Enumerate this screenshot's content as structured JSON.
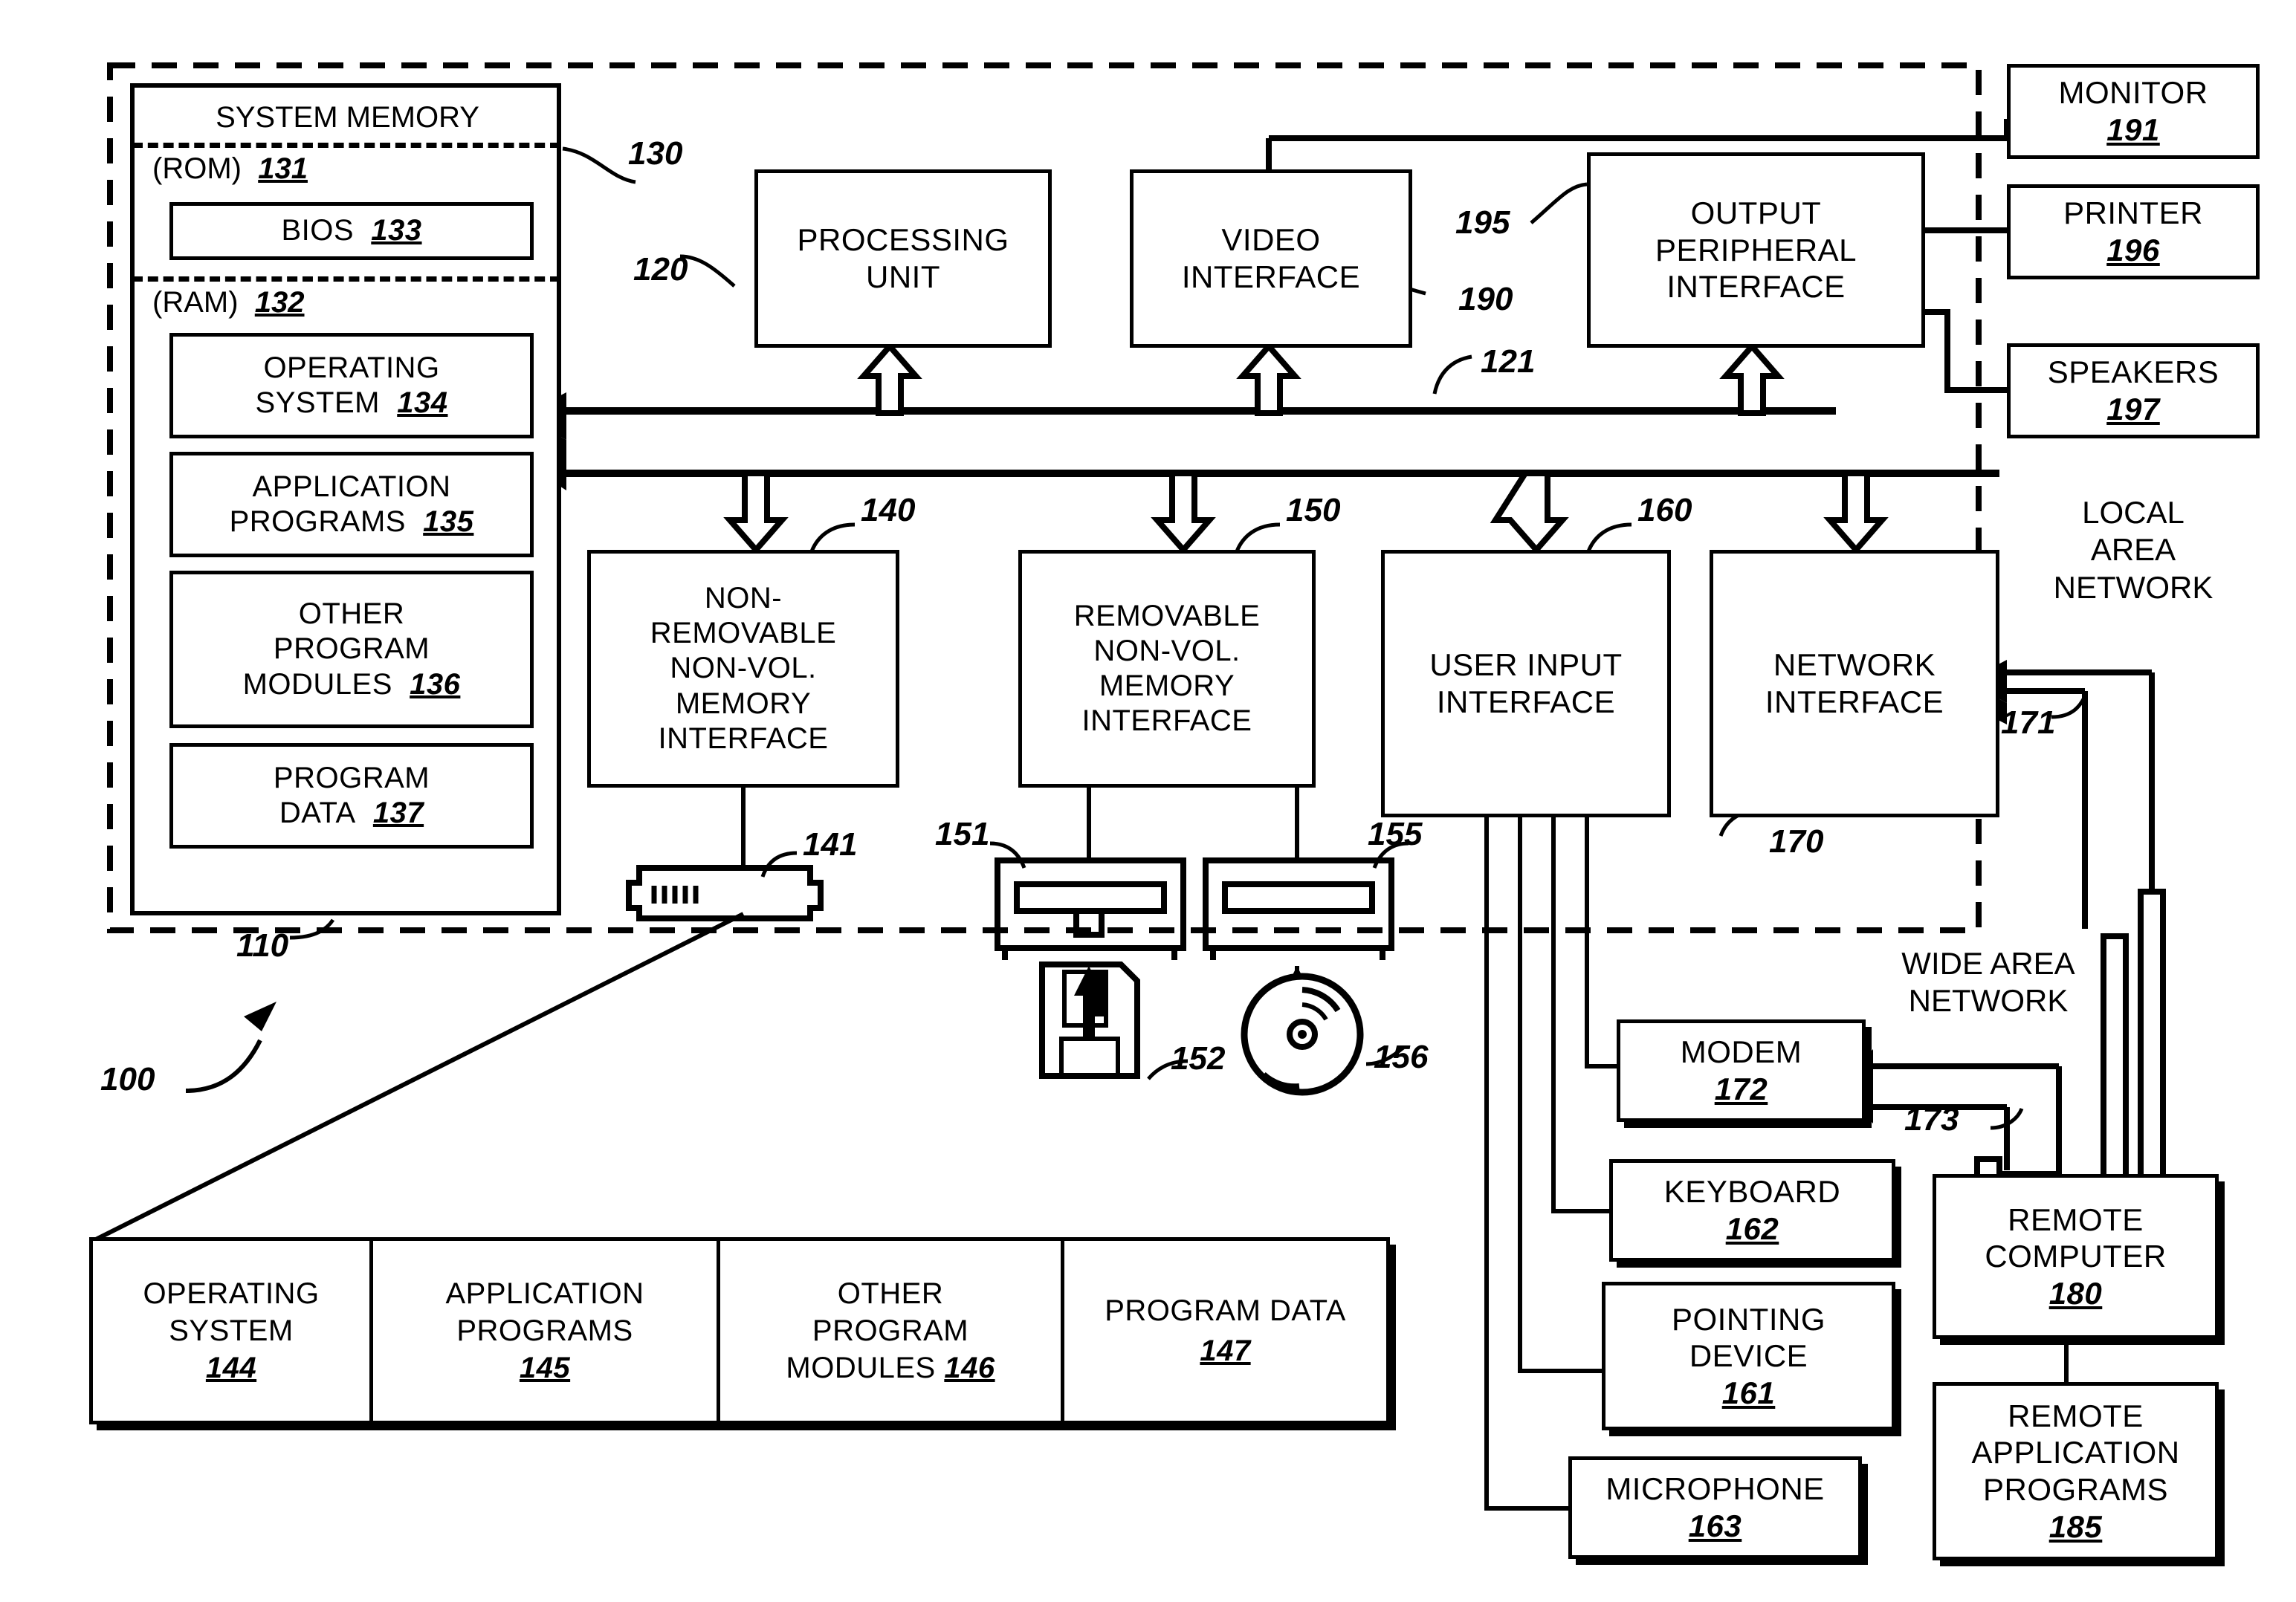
{
  "figure": {
    "overall_ref": "100",
    "computer_ref": "110",
    "system_bus_ref": "121",
    "system_memory_ref": "130",
    "processing_unit_ref": "120",
    "video_interface_ref": "190",
    "output_peripheral_ref": "195",
    "nonremovable_ref": "140",
    "removable_ref": "150",
    "user_input_ref": "160",
    "network_interface_ref": "170",
    "hard_drive_ref": "141",
    "floppy_drive_ref": "151",
    "floppy_disk_ref": "152",
    "optical_drive_ref": "155",
    "optical_disc_ref": "156",
    "lan_link_ref": "171",
    "wan_link_ref": "173"
  },
  "system_memory": {
    "title": "SYSTEM MEMORY",
    "rom": {
      "label": "(ROM)",
      "num": "131"
    },
    "bios": {
      "label": "BIOS",
      "num": "133"
    },
    "ram": {
      "label": "(RAM)",
      "num": "132"
    },
    "blocks": [
      {
        "name": "operating-system",
        "line1": "OPERATING",
        "line2": "SYSTEM",
        "num": "134"
      },
      {
        "name": "application-programs",
        "line1": "APPLICATION",
        "line2": "PROGRAMS",
        "num": "135"
      },
      {
        "name": "other-program-modules",
        "line1": "OTHER",
        "line2": "PROGRAM",
        "line3": "MODULES",
        "num": "136"
      },
      {
        "name": "program-data",
        "line1": "PROGRAM",
        "line2": "DATA",
        "num": "137"
      }
    ]
  },
  "core": {
    "processing_unit": {
      "line1": "PROCESSING",
      "line2": "UNIT"
    },
    "video_interface": {
      "line1": "VIDEO",
      "line2": "INTERFACE"
    },
    "output_peripheral_interface": {
      "line1": "OUTPUT",
      "line2": "PERIPHERAL",
      "line3": "INTERFACE"
    },
    "nonremovable_interface": {
      "line1": "NON-",
      "line2": "REMOVABLE",
      "line3": "NON-VOL.",
      "line4": "MEMORY",
      "line5": "INTERFACE"
    },
    "removable_interface": {
      "line1": "REMOVABLE",
      "line2": "NON-VOL.",
      "line3": "MEMORY",
      "line4": "INTERFACE"
    },
    "user_input_interface": {
      "line1": "USER INPUT",
      "line2": "INTERFACE"
    },
    "network_interface": {
      "line1": "NETWORK",
      "line2": "INTERFACE"
    }
  },
  "output_devices": [
    {
      "name": "monitor",
      "label": "MONITOR",
      "num": "191"
    },
    {
      "name": "printer",
      "label": "PRINTER",
      "num": "196"
    },
    {
      "name": "speakers",
      "label": "SPEAKERS",
      "num": "197"
    }
  ],
  "networks": {
    "lan": "LOCAL\nAREA\nNETWORK",
    "wan": "WIDE AREA\nNETWORK"
  },
  "input_devices": [
    {
      "name": "modem",
      "label": "MODEM",
      "num": "172"
    },
    {
      "name": "keyboard",
      "label": "KEYBOARD",
      "num": "162"
    },
    {
      "name": "pointing-device",
      "line1": "POINTING",
      "line2": "DEVICE",
      "num": "161"
    },
    {
      "name": "microphone",
      "label": "MICROPHONE",
      "num": "163"
    }
  ],
  "remote": {
    "computer": {
      "line1": "REMOTE",
      "line2": "COMPUTER",
      "num": "180"
    },
    "applications": {
      "line1": "REMOTE",
      "line2": "APPLICATION",
      "line3": "PROGRAMS",
      "num": "185"
    }
  },
  "storage_table": {
    "cells": [
      {
        "name": "operating-system",
        "line1": "OPERATING",
        "line2": "SYSTEM",
        "num": "144"
      },
      {
        "name": "application-programs",
        "line1": "APPLICATION",
        "line2": "PROGRAMS",
        "num": "145"
      },
      {
        "name": "other-program-modules",
        "line1": "OTHER",
        "line2": "PROGRAM",
        "line3": "MODULES",
        "num": "146"
      },
      {
        "name": "program-data",
        "line1": "PROGRAM DATA",
        "num": "147"
      }
    ]
  },
  "icons": {
    "hard_drive": "hard-drive-icon",
    "floppy_drive": "floppy-drive-icon",
    "floppy_disk": "floppy-disk-icon",
    "optical_drive": "optical-drive-icon",
    "optical_disc": "optical-disc-icon"
  }
}
